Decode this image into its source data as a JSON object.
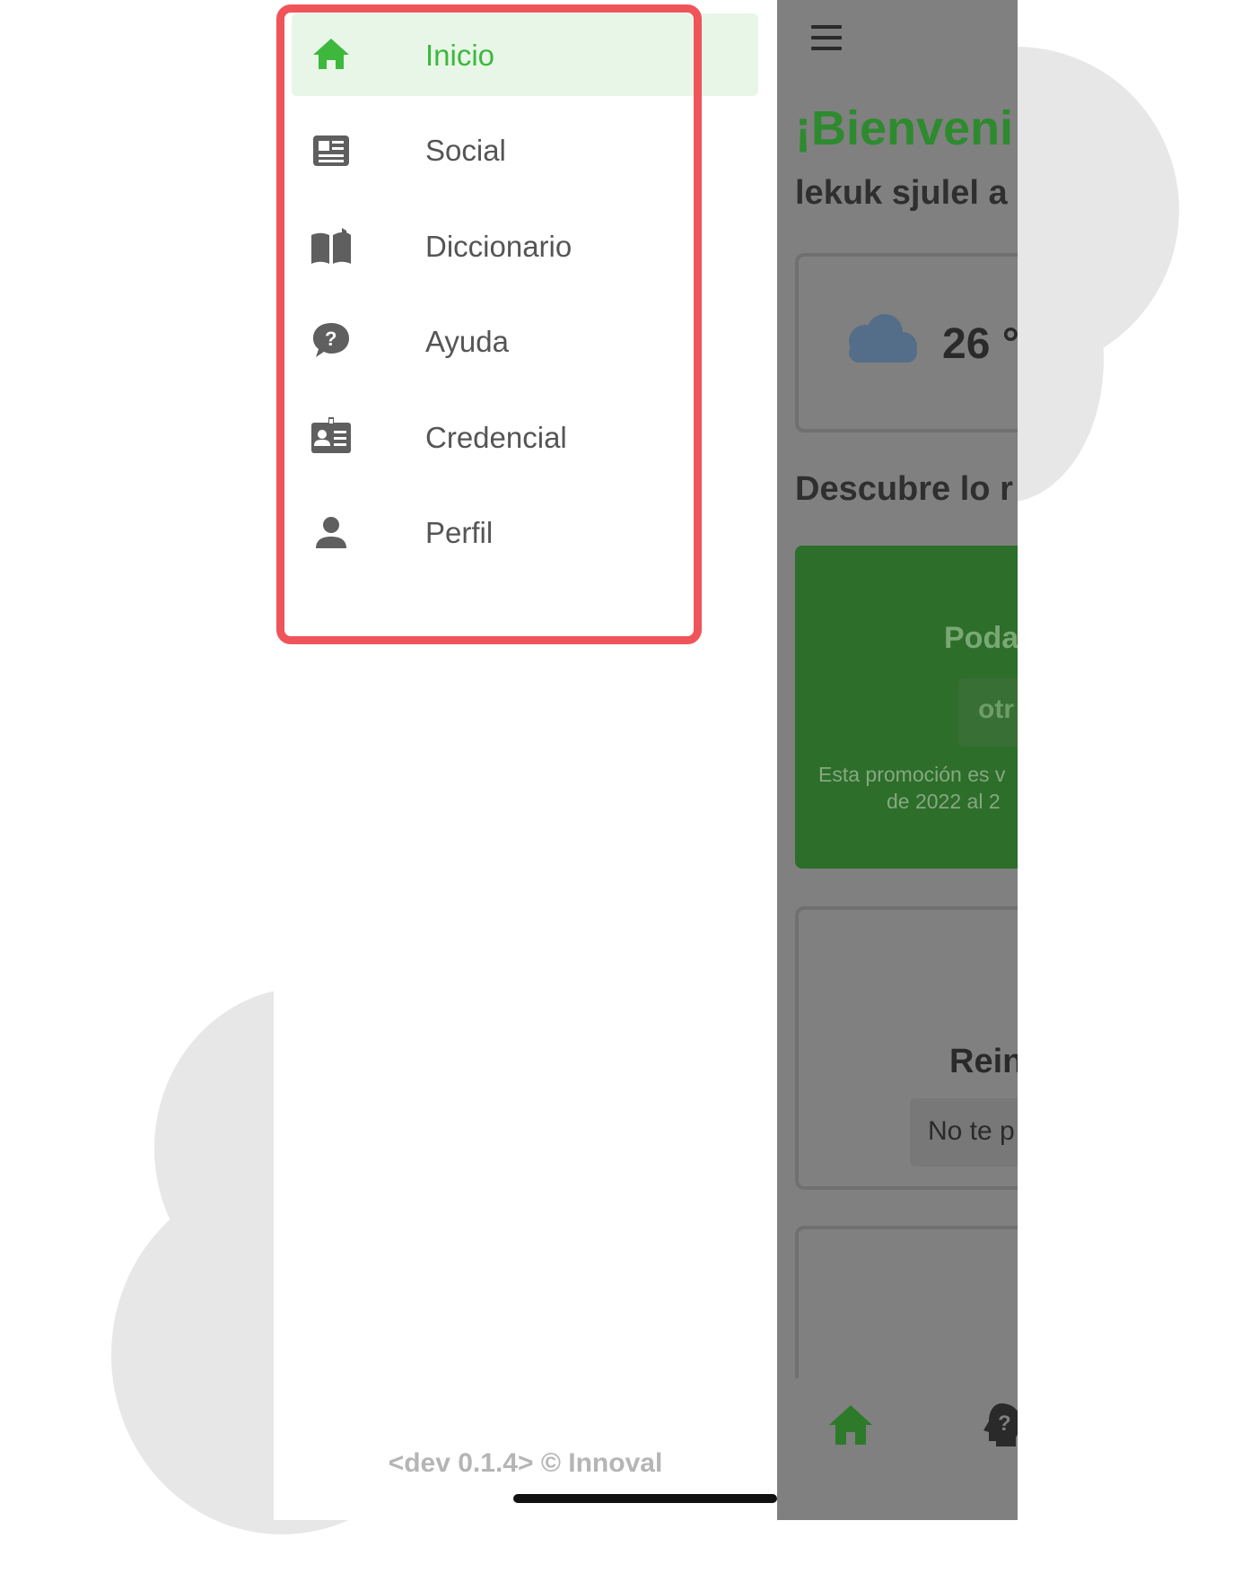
{
  "drawer": {
    "items": [
      {
        "label": "Inicio",
        "icon": "home-icon",
        "active": true
      },
      {
        "label": "Social",
        "icon": "newspaper-icon",
        "active": false
      },
      {
        "label": "Diccionario",
        "icon": "open-book-icon",
        "active": false
      },
      {
        "label": "Ayuda",
        "icon": "help-chat-icon",
        "active": false
      },
      {
        "label": "Credencial",
        "icon": "id-card-icon",
        "active": false
      },
      {
        "label": "Perfil",
        "icon": "person-icon",
        "active": false
      }
    ],
    "footer": "<dev 0.1.4> © Innoval"
  },
  "app": {
    "welcome": "¡Bienveni",
    "subtitle": "lekuk sjulel a",
    "weather": {
      "temperature": "26 °",
      "icon": "cloud-icon"
    },
    "discover_title": "Descubre lo r",
    "promo": {
      "title": "Poda",
      "button": "otr",
      "note_line1": "Esta promoción es v",
      "note_line2": "de 2022 al 2"
    },
    "card2": {
      "title": "Rein",
      "button": "No te p"
    },
    "tabbar": {
      "icons": [
        "home-icon",
        "help-head-icon"
      ]
    }
  },
  "colors": {
    "accent_green": "#3db83d",
    "active_bg": "#e8f6e8",
    "highlight_red": "#f0545b",
    "overlay_gray": "#808080"
  }
}
